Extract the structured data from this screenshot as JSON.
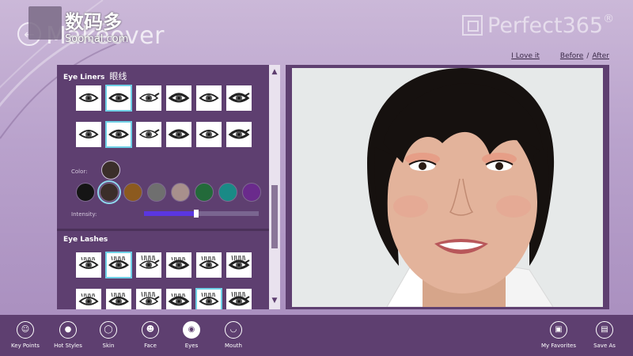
{
  "header": {
    "app_title": "Makeover",
    "brand": "Perfect365",
    "brand_mark": "®",
    "watermark_cn": "数码多",
    "watermark_en": "Soomal.com",
    "links": {
      "love": "I Love it",
      "before": "Before",
      "sep": "/",
      "after": "After"
    }
  },
  "panel": {
    "eye_liners_title": "Eye Liners",
    "eye_liners_title_cn": "眼线",
    "color_label": "Color:",
    "intensity_label": "Intensity:",
    "intensity_value": 0.45,
    "current_color": "#3b2e2a",
    "colors": [
      "#151515",
      "#3b2e2a",
      "#8c5a1f",
      "#6f6f6f",
      "#a8908c",
      "#236a3a",
      "#1a8a86",
      "#6a2a8c"
    ],
    "selected_color_index": 1,
    "liner_selected_index": 1,
    "liner_selected_index_row2": 1,
    "eye_lashes_title": "Eye Lashes",
    "lash_selected_index": 1,
    "lash_selected_index_row2": 4
  },
  "toolbar": {
    "items": [
      {
        "label": "Key Points",
        "icon": "smiley-icon"
      },
      {
        "label": "Hot Styles",
        "icon": "person-icon"
      },
      {
        "label": "Skin",
        "icon": "skin-icon"
      },
      {
        "label": "Face",
        "icon": "face-icon"
      },
      {
        "label": "Eyes",
        "icon": "eye-icon"
      },
      {
        "label": "Mouth",
        "icon": "lips-icon"
      }
    ],
    "favorites_label": "My Favorites",
    "save_label": "Save As",
    "active_index": 4
  }
}
